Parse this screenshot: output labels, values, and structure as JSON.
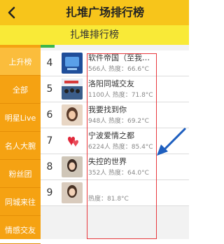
{
  "header": {
    "title": "扎堆广场排行榜",
    "back_icon": "chevron-left-icon",
    "background": "#f7c51b"
  },
  "subheader": {
    "title": "扎堆排行榜",
    "background": "#f9ea37"
  },
  "sidebar": {
    "background": "#f5a212",
    "items": [
      {
        "label": "上升榜",
        "active": true
      },
      {
        "label": "全部",
        "active": false
      },
      {
        "label": "明星Live",
        "active": false
      },
      {
        "label": "名人大腕",
        "active": false
      },
      {
        "label": "粉丝团",
        "active": false
      },
      {
        "label": "同城来往",
        "active": false
      },
      {
        "label": "情感交友",
        "active": false
      }
    ]
  },
  "list": {
    "rows": [
      {
        "rank": "4",
        "name": "软件帝国（至我…",
        "meta": "566人    热度：66.6°C",
        "avatar": "app-icon"
      },
      {
        "rank": "5",
        "name": "洛阳同城交友",
        "meta": "1100人   热度：71.8°C",
        "avatar": "group-photo-icon"
      },
      {
        "rank": "6",
        "name": "我要找到你",
        "meta": "948人    热度：69.2°C",
        "avatar": "portrait-icon"
      },
      {
        "rank": "7",
        "name": "宁波爱情之都",
        "meta": "6224人   热度：85.4°C",
        "avatar": "heart-icon"
      },
      {
        "rank": "8",
        "name": "失控的世界",
        "meta": "352人    热度：64.0°C",
        "avatar": "portrait-icon"
      },
      {
        "rank": "9",
        "name": "",
        "meta": "热度：81.8°C",
        "avatar": "portrait-icon"
      }
    ]
  },
  "annotation": {
    "box_color": "#e8383d",
    "arrow_color": "#1e5fbf",
    "arrow_icon": "arrow-pointing-left-icon"
  }
}
